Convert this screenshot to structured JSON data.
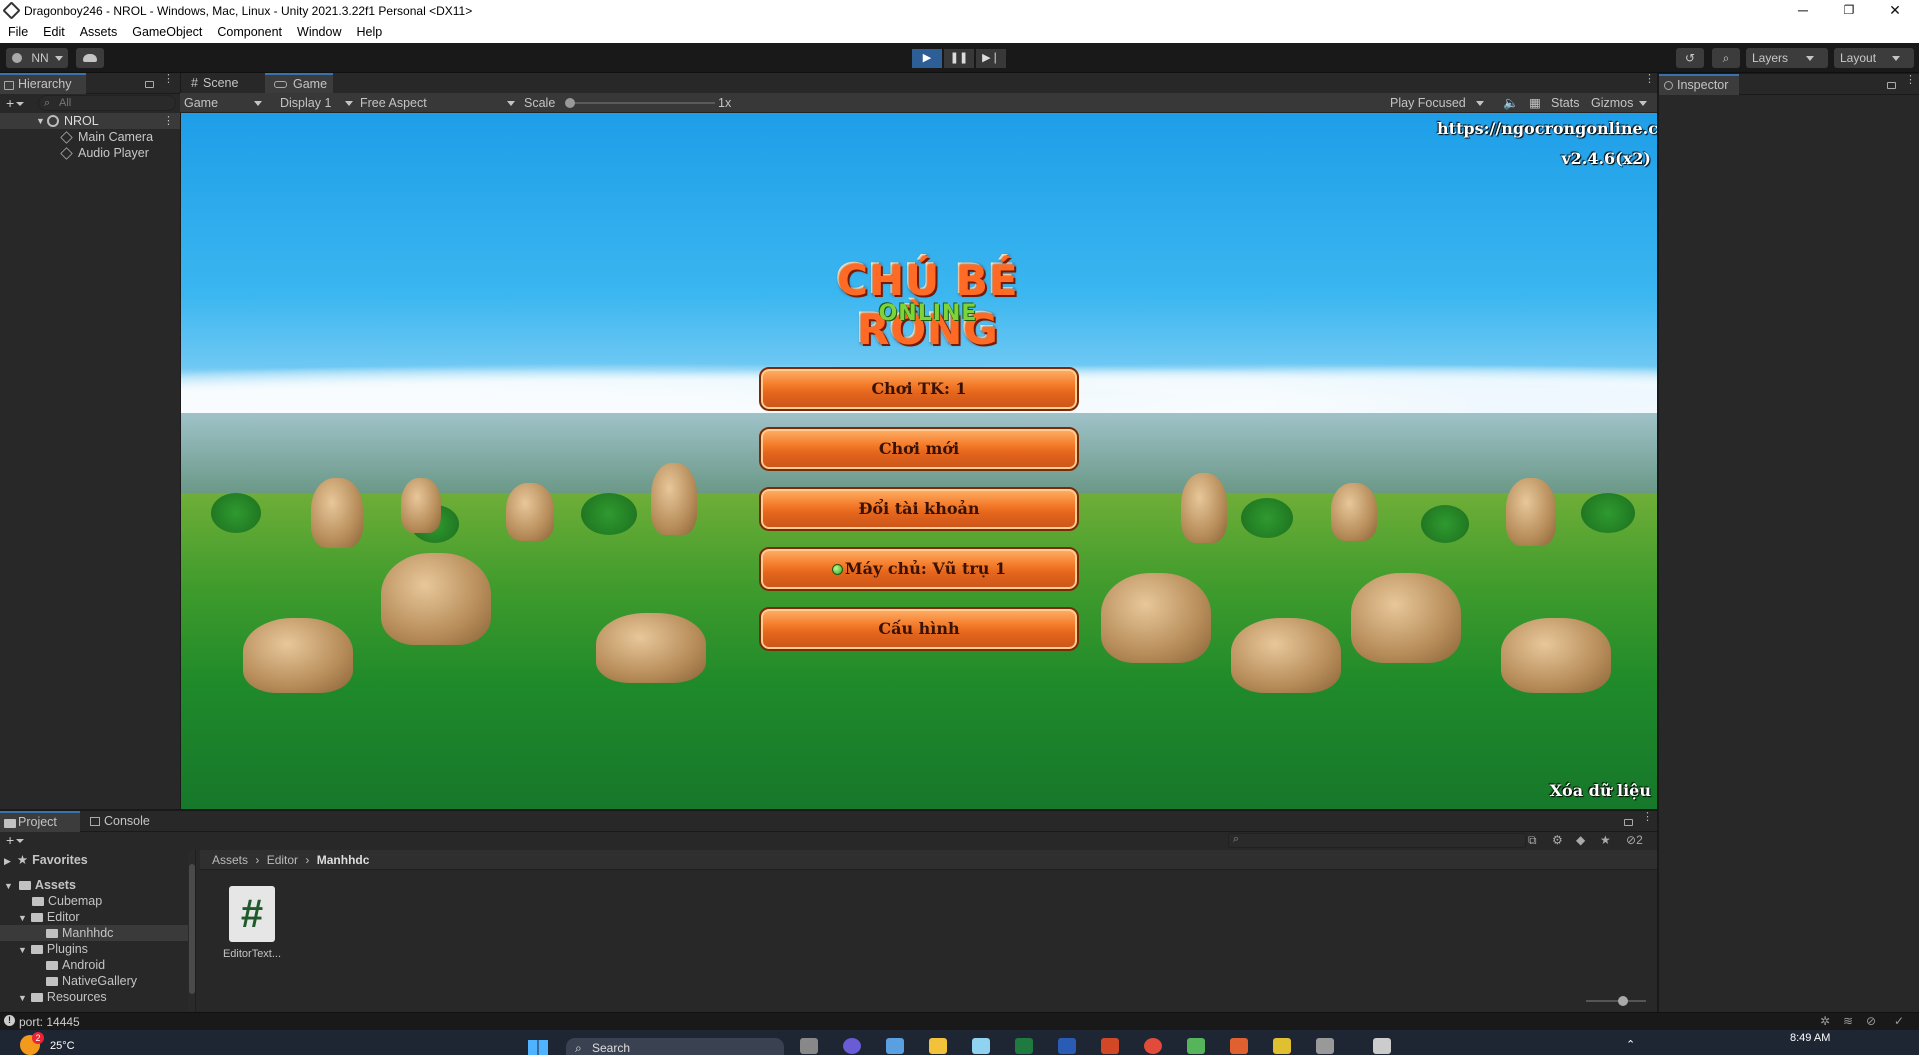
{
  "window": {
    "title": "Dragonboy246 - NROL - Windows, Mac, Linux - Unity 2021.3.22f1 Personal <DX11>",
    "minimize": "─",
    "restore": "❐",
    "close": "✕"
  },
  "menu": [
    "File",
    "Edit",
    "Assets",
    "GameObject",
    "Component",
    "Window",
    "Help"
  ],
  "toolbar": {
    "account": "NN",
    "layers": "Layers",
    "layout": "Layout"
  },
  "hierarchy": {
    "tab": "Hierarchy",
    "search_placeholder": "All",
    "scene": "NROL",
    "items": [
      "Main Camera",
      "Audio Player"
    ]
  },
  "center_tabs": [
    "Scene",
    "Game"
  ],
  "gamebar": {
    "mode": "Game",
    "display": "Display 1",
    "aspect": "Free Aspect",
    "scale_label": "Scale",
    "scale_value": "1x",
    "play_focused": "Play Focused",
    "stats": "Stats",
    "gizmos": "Gizmos"
  },
  "game": {
    "logo_main": "CHÚ BÉ RỒNG",
    "logo_sub": "ONLINE",
    "url": "https://ngocrongonline.com",
    "version": "v2.4.6(x2)",
    "buttons": [
      "Chơi TK: 1",
      "Chơi mới",
      "Đổi tài khoản",
      "Máy chủ: Vũ trụ 1",
      "Cấu hình"
    ],
    "clear_data": "Xóa dữ liệu"
  },
  "inspector": {
    "tab": "Inspector"
  },
  "project": {
    "tabs": [
      "Project",
      "Console"
    ],
    "favorites": "Favorites",
    "tree": [
      "Assets",
      "Cubemap",
      "Editor",
      "Manhhdc",
      "Plugins",
      "Android",
      "NativeGallery",
      "Resources"
    ],
    "breadcrumb": [
      "Assets",
      "Editor",
      "Manhhdc"
    ],
    "asset_name": "EditorText...",
    "asset_glyph": "#",
    "hidden_count": "2"
  },
  "status": {
    "text": "port: 14445"
  },
  "taskbar": {
    "weather_badge": "2",
    "temperature": "25°C",
    "search": "Search",
    "time": "8:49 AM"
  },
  "colors": {
    "accent_blue": "#3a72b0",
    "button_orange": "#f47b2a",
    "sky_blue": "#1e9ee8",
    "grass_green": "#1f8a2a"
  }
}
